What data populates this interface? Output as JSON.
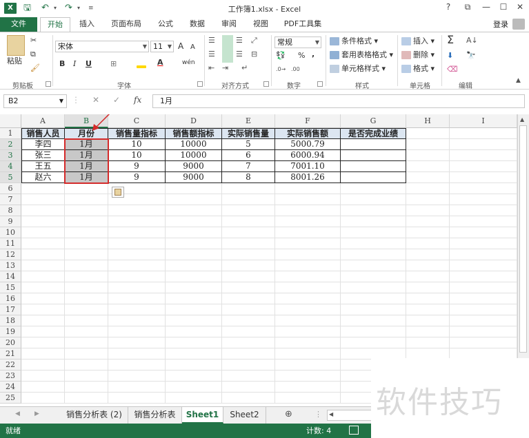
{
  "window": {
    "title": "工作簿1.xlsx - Excel",
    "help": "?",
    "restore": "⧉",
    "minimize": "—",
    "maximize": "☐",
    "close": "✕"
  },
  "tabs": [
    {
      "label": "文件"
    },
    {
      "label": "开始"
    },
    {
      "label": "插入"
    },
    {
      "label": "页面布局"
    },
    {
      "label": "公式"
    },
    {
      "label": "数据"
    },
    {
      "label": "审阅"
    },
    {
      "label": "视图"
    },
    {
      "label": "PDF工具集"
    }
  ],
  "login_label": "登录",
  "ribbon": {
    "clipboard": {
      "label": "剪贴板",
      "paste": "粘贴"
    },
    "font": {
      "label": "字体",
      "name": "宋体",
      "size": "11",
      "grow": "A",
      "shrink": "A",
      "bold": "B",
      "italic": "I",
      "underline": "U",
      "phonetic": "wén"
    },
    "align": {
      "label": "对齐方式"
    },
    "number": {
      "label": "数字",
      "format": "常规",
      "percent": "%",
      "comma": ","
    },
    "styles": {
      "label": "样式",
      "conditional": "条件格式",
      "table": "套用表格格式",
      "cell": "单元格样式"
    },
    "cells": {
      "label": "单元格",
      "insert": "插入",
      "delete": "删除",
      "format": "格式"
    },
    "edit": {
      "label": "编辑",
      "sum": "Σ"
    }
  },
  "formula_bar": {
    "name_box": "B2",
    "cancel": "✕",
    "enter": "✓",
    "fx": "fx",
    "content": "1月"
  },
  "columns": [
    "A",
    "B",
    "C",
    "D",
    "E",
    "F",
    "G",
    "H",
    "I"
  ],
  "selected_column": "B",
  "rows": [
    "1",
    "2",
    "3",
    "4",
    "5",
    "6",
    "7",
    "8",
    "9",
    "10",
    "11",
    "12",
    "13",
    "14",
    "15",
    "16",
    "17",
    "18",
    "19",
    "20",
    "21",
    "22",
    "23",
    "24",
    "25"
  ],
  "table": {
    "headers": [
      "销售人员",
      "月份",
      "销售量指标",
      "销售额指标",
      "实际销售量",
      "实际销售额",
      "是否完成业绩"
    ],
    "rows": [
      [
        "李四",
        "1月",
        "10",
        "10000",
        "5",
        "5000.79",
        ""
      ],
      [
        "张三",
        "1月",
        "10",
        "10000",
        "6",
        "6000.94",
        ""
      ],
      [
        "王五",
        "1月",
        "9",
        "9000",
        "7",
        "7001.10",
        ""
      ],
      [
        "赵六",
        "1月",
        "9",
        "9000",
        "8",
        "8001.26",
        ""
      ]
    ]
  },
  "sheets": [
    {
      "label": "销售分析表 (2)"
    },
    {
      "label": "销售分析表"
    },
    {
      "label": "Sheet1"
    },
    {
      "label": "Sheet2"
    }
  ],
  "active_sheet": "Sheet1",
  "status": {
    "mode": "就绪",
    "count": "计数: 4"
  },
  "watermark": "软件技巧",
  "colors": {
    "accent": "#217346",
    "selection": "#d42a2a",
    "header_fill": "#dce6f1"
  }
}
